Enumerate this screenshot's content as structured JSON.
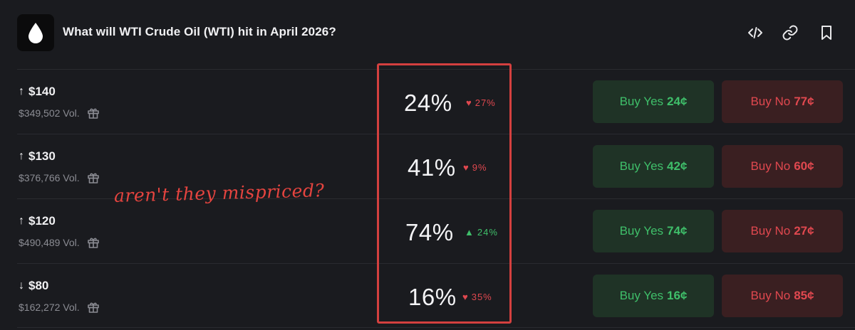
{
  "market": {
    "title": "What will WTI Crude Oil (WTI) hit in April 2026?",
    "icon": "oil-drop-icon"
  },
  "header_icons": [
    "embed-code-icon",
    "link-icon",
    "bookmark-icon"
  ],
  "colors": {
    "background": "#1a1b1f",
    "yes_text": "#3fbf6a",
    "yes_bg": "#1f3326",
    "no_text": "#e0484f",
    "no_bg": "#3a1f21",
    "annotation": "#d4403f"
  },
  "outcomes": [
    {
      "arrow": "↑",
      "threshold": "$140",
      "volume": "$349,502 Vol.",
      "probability": "24%",
      "change_direction": "down",
      "change_marker": "♥",
      "change": "27%",
      "buy_yes_label": "Buy Yes",
      "buy_yes_price": "24¢",
      "buy_no_label": "Buy No",
      "buy_no_price": "77¢"
    },
    {
      "arrow": "↑",
      "threshold": "$130",
      "volume": "$376,766 Vol.",
      "probability": "41%",
      "change_direction": "down",
      "change_marker": "♥",
      "change": "9%",
      "buy_yes_label": "Buy Yes",
      "buy_yes_price": "42¢",
      "buy_no_label": "Buy No",
      "buy_no_price": "60¢"
    },
    {
      "arrow": "↑",
      "threshold": "$120",
      "volume": "$490,489 Vol.",
      "probability": "74%",
      "change_direction": "up",
      "change_marker": "▲",
      "change": "24%",
      "buy_yes_label": "Buy Yes",
      "buy_yes_price": "74¢",
      "buy_no_label": "Buy No",
      "buy_no_price": "27¢"
    },
    {
      "arrow": "↓",
      "threshold": "$80",
      "volume": "$162,272 Vol.",
      "probability": "16%",
      "change_direction": "down",
      "change_marker": "♥",
      "change": "35%",
      "buy_yes_label": "Buy Yes",
      "buy_yes_price": "16¢",
      "buy_no_label": "Buy No",
      "buy_no_price": "85¢"
    }
  ],
  "annotation": {
    "text": "aren't they mispriced?"
  }
}
